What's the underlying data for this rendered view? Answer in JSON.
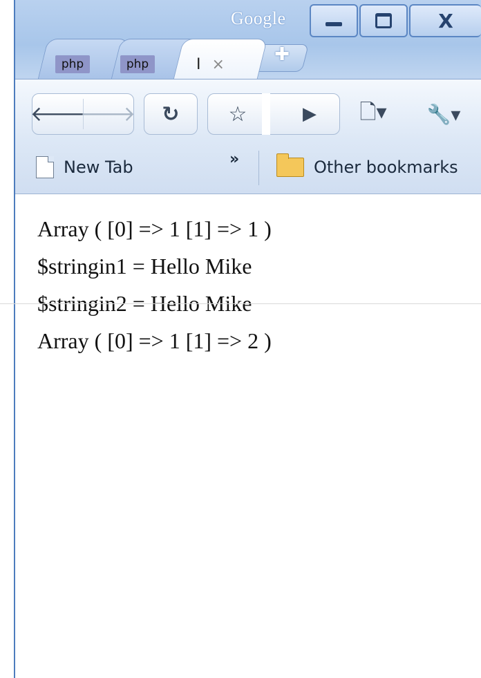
{
  "window": {
    "title": "Google"
  },
  "tabs": [
    {
      "label": "php",
      "active": false
    },
    {
      "label": "php",
      "active": false
    },
    {
      "label": "I",
      "active": true
    }
  ],
  "icons": {
    "minimize": "minimize-icon",
    "maximize": "maximize-icon",
    "close": "close-icon",
    "new_tab": "plus-icon",
    "back": "back-arrow-icon",
    "forward": "forward-arrow-icon",
    "reload": "reload-icon",
    "star": "star-icon",
    "go": "play-icon",
    "page": "page-menu-icon",
    "tools": "wrench-icon"
  },
  "bookmarks": {
    "items": [
      {
        "label": "New Tab",
        "icon": "document-icon"
      }
    ],
    "overflow": "»",
    "other_label": "Other bookmarks"
  },
  "content": {
    "lines": [
      "Array ( [0] => 1 [1] => 1 )",
      "$stringin1 = Hello Mike",
      "$stringin2 = Hello Mike",
      "Array ( [0] => 1 [1] => 2 )"
    ]
  },
  "colors": {
    "frame": "#c9dcf3",
    "frame_border": "#4d7cbd",
    "favicon_php": "#8f95c8",
    "folder": "#f4c75a"
  }
}
